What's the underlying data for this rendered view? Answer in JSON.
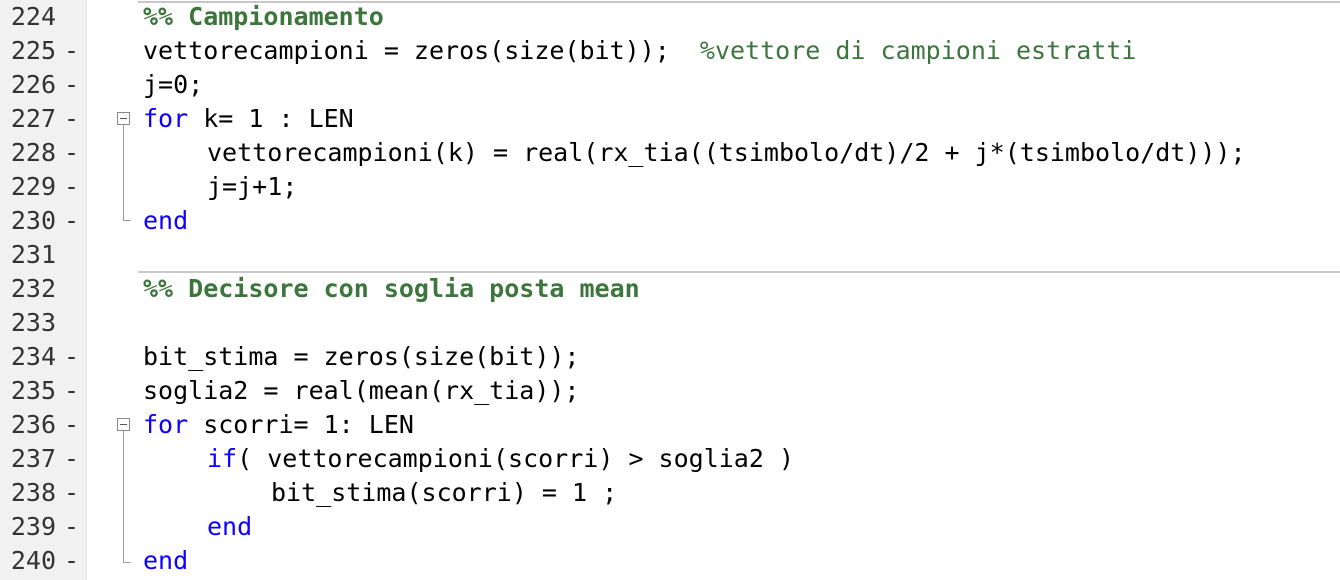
{
  "editor": {
    "lines": [
      {
        "num": "224",
        "dash": "",
        "parts": [
          {
            "t": "%% Campionamento",
            "c": "sec"
          }
        ]
      },
      {
        "num": "225",
        "dash": "-",
        "parts": [
          {
            "t": "vettorecampioni = zeros(size(bit));  ",
            "c": ""
          },
          {
            "t": "%vettore di campioni estratti",
            "c": "cm"
          }
        ]
      },
      {
        "num": "226",
        "dash": "-",
        "parts": [
          {
            "t": "j=0;",
            "c": ""
          }
        ]
      },
      {
        "num": "227",
        "dash": "-",
        "parts": [
          {
            "t": "for",
            "c": "kw"
          },
          {
            "t": " k= 1 : LEN",
            "c": ""
          }
        ]
      },
      {
        "num": "228",
        "dash": "-",
        "parts": [
          {
            "t": "vettorecampioni(k) = real(rx_tia((tsimbolo/dt)/2 + j*(tsimbolo/dt)));",
            "c": ""
          }
        ]
      },
      {
        "num": "229",
        "dash": "-",
        "parts": [
          {
            "t": "j=j+1;",
            "c": ""
          }
        ]
      },
      {
        "num": "230",
        "dash": "-",
        "parts": [
          {
            "t": "end",
            "c": "kw"
          }
        ]
      },
      {
        "num": "231",
        "dash": "",
        "parts": []
      },
      {
        "num": "232",
        "dash": "",
        "parts": [
          {
            "t": "%% Decisore con soglia posta mean",
            "c": "sec"
          }
        ]
      },
      {
        "num": "233",
        "dash": "",
        "parts": []
      },
      {
        "num": "234",
        "dash": "-",
        "parts": [
          {
            "t": "bit_stima = zeros(size(bit));",
            "c": ""
          }
        ]
      },
      {
        "num": "235",
        "dash": "-",
        "parts": [
          {
            "t": "soglia2 = real(mean(rx_tia));",
            "c": ""
          }
        ]
      },
      {
        "num": "236",
        "dash": "-",
        "parts": [
          {
            "t": "for",
            "c": "kw"
          },
          {
            "t": " scorri= 1: LEN",
            "c": ""
          }
        ]
      },
      {
        "num": "237",
        "dash": "-",
        "parts": [
          {
            "t": "if",
            "c": "kw"
          },
          {
            "t": "( vettorecampioni(scorri) > soglia2 )",
            "c": ""
          }
        ]
      },
      {
        "num": "238",
        "dash": "-",
        "parts": [
          {
            "t": "bit_stima(scorri) = 1 ;",
            "c": ""
          }
        ]
      },
      {
        "num": "239",
        "dash": "-",
        "parts": [
          {
            "t": "end",
            "c": "kw"
          }
        ]
      },
      {
        "num": "240",
        "dash": "-",
        "parts": [
          {
            "t": "end",
            "c": "kw"
          }
        ]
      }
    ]
  },
  "colors": {
    "keyword": "#0e00ff",
    "comment": "#3c763d",
    "gutter": "#f1f1f1"
  }
}
